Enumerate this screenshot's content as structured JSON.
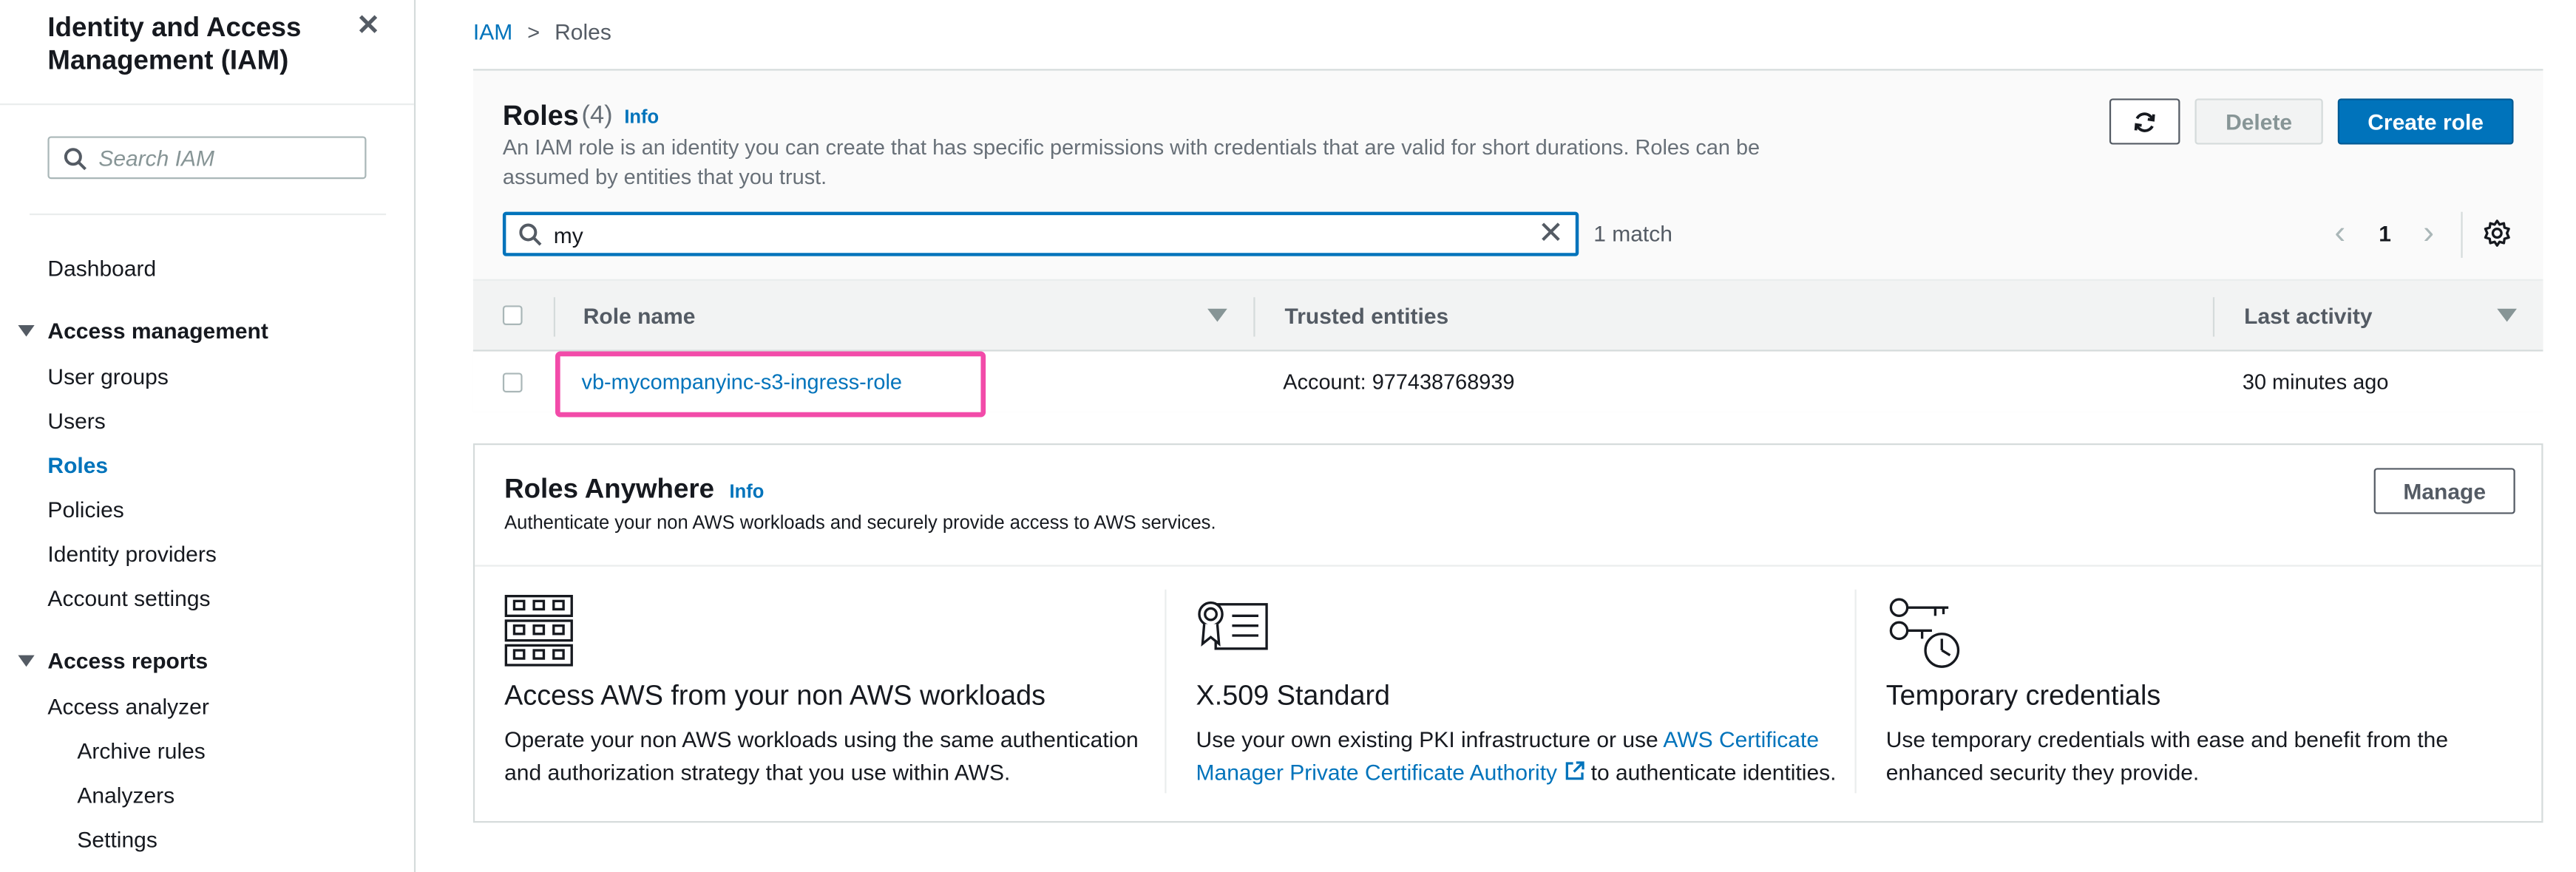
{
  "sidebar": {
    "title": "Identity and Access Management (IAM)",
    "search_placeholder": "Search IAM",
    "dashboard": "Dashboard",
    "access_management": {
      "label": "Access management",
      "items": [
        "User groups",
        "Users",
        "Roles",
        "Policies",
        "Identity providers",
        "Account settings"
      ]
    },
    "access_reports": {
      "label": "Access reports",
      "items": [
        "Access analyzer"
      ],
      "subitems": [
        "Archive rules",
        "Analyzers",
        "Settings"
      ]
    },
    "active_item": "Roles"
  },
  "breadcrumb": {
    "root": "IAM",
    "current": "Roles"
  },
  "roles_panel": {
    "title": "Roles",
    "count": "(4)",
    "info": "Info",
    "description": "An IAM role is an identity you can create that has specific permissions with credentials that are valid for short durations. Roles can be assumed by entities that you trust.",
    "delete_label": "Delete",
    "create_label": "Create role",
    "filter_value": "my",
    "match_text": "1 match",
    "page": "1",
    "columns": {
      "role_name": "Role name",
      "trusted_entities": "Trusted entities",
      "last_activity": "Last activity"
    },
    "rows": [
      {
        "role_name": "vb-mycompanyinc-s3-ingress-role",
        "trusted_entities": "Account: 977438768939",
        "last_activity": "30 minutes ago"
      }
    ]
  },
  "roles_anywhere": {
    "title": "Roles Anywhere",
    "info": "Info",
    "description": "Authenticate your non AWS workloads and securely provide access to AWS services.",
    "manage_label": "Manage",
    "features": [
      {
        "icon": "server-rack-icon",
        "heading": "Access AWS from your non AWS workloads",
        "text": "Operate your non AWS workloads using the same authentication and authorization strategy that you use within AWS."
      },
      {
        "icon": "certificate-icon",
        "heading": "X.509 Standard",
        "text_before": "Use your own existing PKI infrastructure or use ",
        "link": "AWS Certificate Manager Private Certificate Authority",
        "text_after": " to authenticate identities."
      },
      {
        "icon": "keys-clock-icon",
        "heading": "Temporary credentials",
        "text": "Use temporary credentials with ease and benefit from the enhanced security they provide."
      }
    ]
  },
  "colors": {
    "link": "#0073bb",
    "primary_button": "#0073bb",
    "highlight": "#f24ba9"
  }
}
